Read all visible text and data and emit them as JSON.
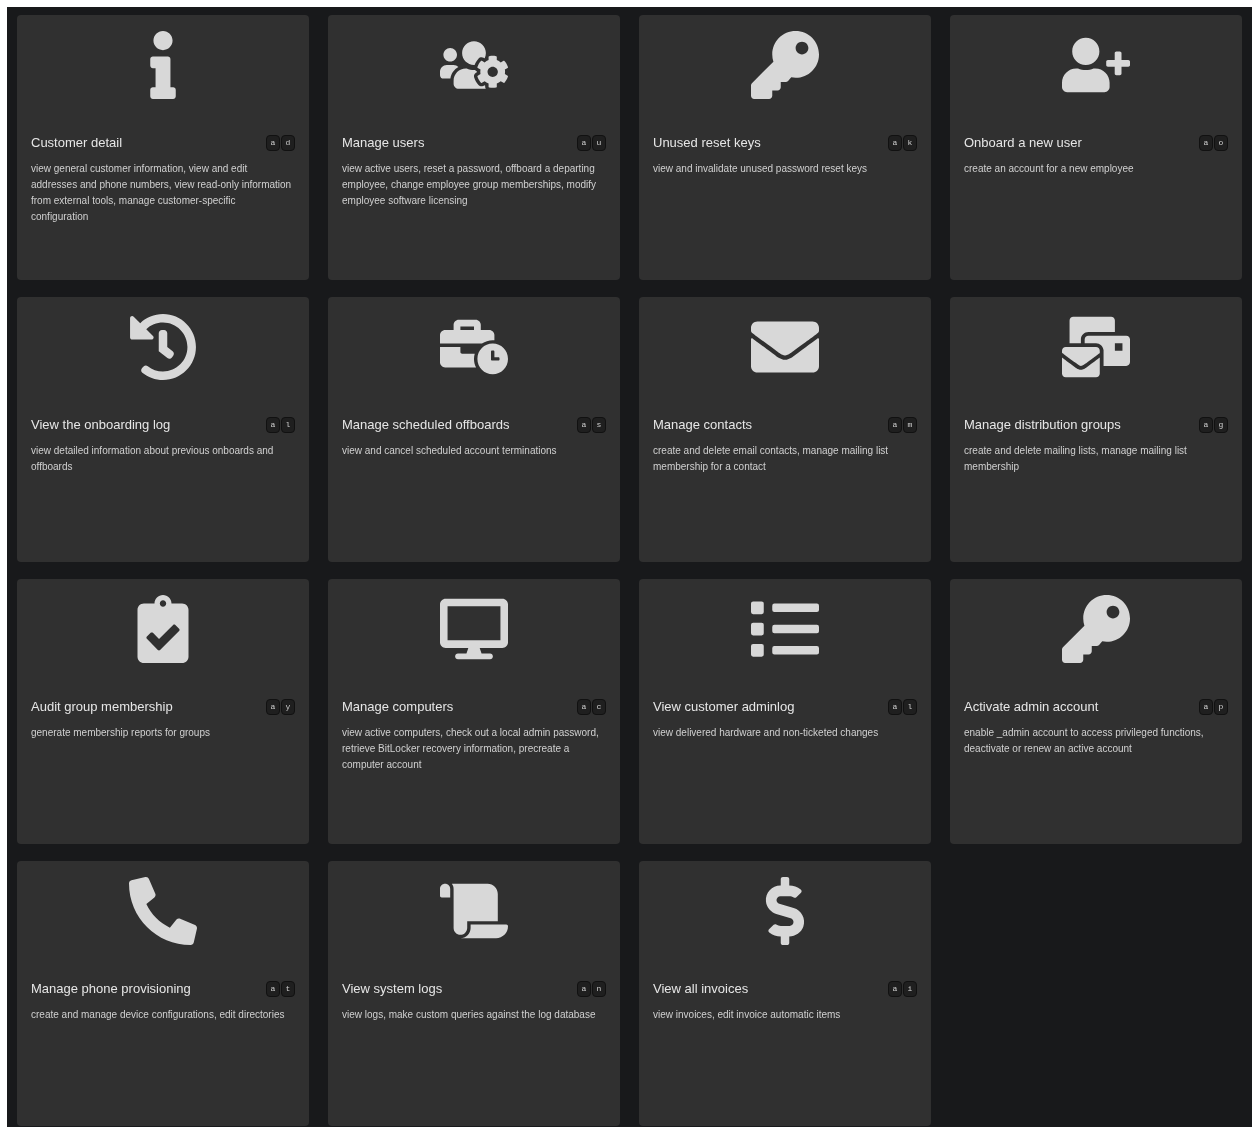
{
  "cards": [
    {
      "title": "Customer detail",
      "keys": [
        "a",
        "d"
      ],
      "description": "view general customer information, view and edit addresses and phone numbers, view read-only information from external tools, manage customer-specific configuration"
    },
    {
      "title": "Manage users",
      "keys": [
        "a",
        "u"
      ],
      "description": "view active users, reset a password, offboard a departing employee, change employee group memberships, modify employee software licensing"
    },
    {
      "title": "Unused reset keys",
      "keys": [
        "a",
        "k"
      ],
      "description": "view and invalidate unused password reset keys"
    },
    {
      "title": "Onboard a new user",
      "keys": [
        "a",
        "o"
      ],
      "description": "create an account for a new employee"
    },
    {
      "title": "View the onboarding log",
      "keys": [
        "a",
        "l"
      ],
      "description": "view detailed information about previous onboards and offboards"
    },
    {
      "title": "Manage scheduled offboards",
      "keys": [
        "a",
        "s"
      ],
      "description": "view and cancel scheduled account terminations"
    },
    {
      "title": "Manage contacts",
      "keys": [
        "a",
        "m"
      ],
      "description": "create and delete email contacts, manage mailing list membership for a contact"
    },
    {
      "title": "Manage distribution groups",
      "keys": [
        "a",
        "g"
      ],
      "description": "create and delete mailing lists, manage mailing list membership"
    },
    {
      "title": "Audit group membership",
      "keys": [
        "a",
        "y"
      ],
      "description": "generate membership reports for groups"
    },
    {
      "title": "Manage computers",
      "keys": [
        "a",
        "c"
      ],
      "description": "view active computers, check out a local admin password, retrieve BitLocker recovery information, precreate a computer account"
    },
    {
      "title": "View customer adminlog",
      "keys": [
        "a",
        "l"
      ],
      "description": "view delivered hardware and non-ticketed changes"
    },
    {
      "title": "Activate admin account",
      "keys": [
        "a",
        "p"
      ],
      "description": "enable _admin account to access privileged functions, deactivate or renew an active account"
    },
    {
      "title": "Manage phone provisioning",
      "keys": [
        "a",
        "t"
      ],
      "description": "create and manage device configurations, edit directories"
    },
    {
      "title": "View system logs",
      "keys": [
        "a",
        "n"
      ],
      "description": "view logs, make custom queries against the log database"
    },
    {
      "title": "View all invoices",
      "keys": [
        "a",
        "i"
      ],
      "description": "view invoices, edit invoice automatic items"
    }
  ]
}
